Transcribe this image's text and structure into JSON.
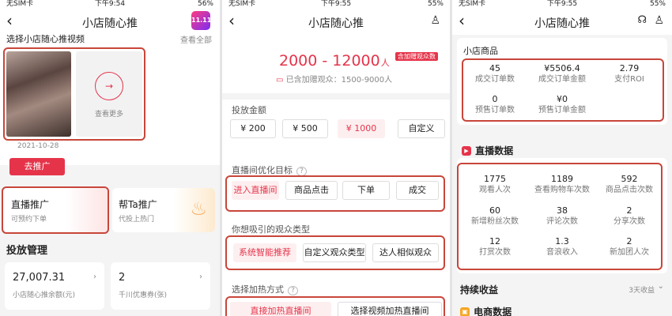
{
  "phone1": {
    "status": {
      "carrier": "无SIM卡",
      "time": "下午9:54",
      "battery": "56%"
    },
    "nav": {
      "title": "小店随心推"
    },
    "promo_badge": "11.11",
    "section_title": "选择小店随心推视频",
    "view_all": "查看全部",
    "video_date": "2021-10-28",
    "more_label": "查看更多",
    "promote_button": "去推广",
    "live_promo": {
      "title": "直播推广",
      "subtitle": "可预约下单"
    },
    "help_promo": {
      "title": "帮Ta推广",
      "subtitle": "代投上热门"
    },
    "manage_title": "投放管理",
    "balance": {
      "value": "27,007.31",
      "label": "小店随心推余额(元)"
    },
    "coupons": {
      "value": "2",
      "label": "千川优惠券(张)"
    }
  },
  "phone2": {
    "status": {
      "carrier": "无SIM卡",
      "time": "下午9:55",
      "battery": "55%"
    },
    "nav": {
      "title": "小店随心推"
    },
    "audience_range": "2000 - 12000",
    "audience_unit": "人",
    "gift_tag": "含加赠观众数",
    "gift_note": "已含加赠观众：1500-9000人",
    "amount_label": "投放金额",
    "amounts": [
      "¥ 200",
      "¥ 500",
      "¥ 1000",
      "自定义"
    ],
    "goal_label": "直播间优化目标",
    "goals": [
      "进入直播间",
      "商品点击",
      "下单",
      "成交"
    ],
    "audience_label": "你想吸引的观众类型",
    "audiences": [
      "系统智能推荐",
      "自定义观众类型",
      "达人相似观众"
    ],
    "heat_label": "选择加热方式",
    "heat_methods": [
      "直接加热直播间",
      "选择视频加热直播间"
    ]
  },
  "phone3": {
    "status": {
      "carrier": "无SIM卡",
      "time": "下午9:55",
      "battery": "55%"
    },
    "nav": {
      "title": "小店随心推"
    },
    "shop_title": "小店商品",
    "shop_stats": [
      {
        "value": "45",
        "label": "成交订单数"
      },
      {
        "value": "¥5506.4",
        "label": "成交订单金额"
      },
      {
        "value": "2.79",
        "label": "支付ROI"
      },
      {
        "value": "0",
        "label": "预售订单数"
      },
      {
        "value": "¥0",
        "label": "预售订单金额"
      }
    ],
    "live_title": "直播数据",
    "live_stats": [
      {
        "value": "1775",
        "label": "观看人次"
      },
      {
        "value": "1189",
        "label": "查看购物车次数"
      },
      {
        "value": "592",
        "label": "商品点击次数"
      },
      {
        "value": "60",
        "label": "新增粉丝次数"
      },
      {
        "value": "38",
        "label": "评论次数"
      },
      {
        "value": "2",
        "label": "分享次数"
      },
      {
        "value": "12",
        "label": "打赏次数"
      },
      {
        "value": "1.3",
        "label": "音浪收入"
      },
      {
        "value": "2",
        "label": "新加团人次"
      }
    ],
    "income_title": "持续收益",
    "income_days": "3天收益",
    "ecommerce_title": "电商数据"
  }
}
